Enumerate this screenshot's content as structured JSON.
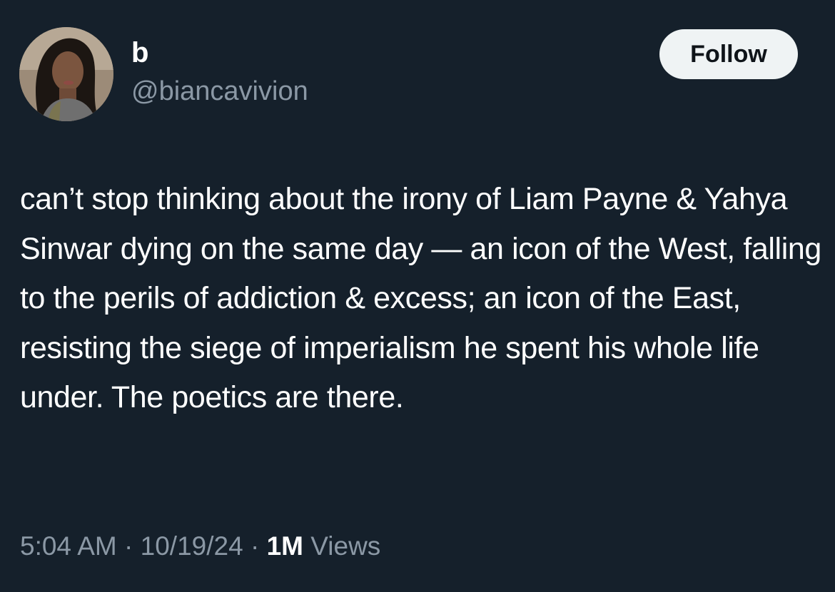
{
  "author": {
    "display_name": "b",
    "handle": "@biancavivion",
    "avatar_icon": "user-avatar-photo"
  },
  "follow_button": {
    "label": "Follow"
  },
  "tweet": {
    "text": "can’t stop thinking about the irony of Liam Payne & Yahya Sinwar dying on the same day — an icon of the West, falling to the perils of addiction & excess; an icon of the East, resisting the siege of imperialism he spent his whole life under. The poetics are there."
  },
  "meta": {
    "time": "5:04 AM",
    "separator": "·",
    "date": "10/19/24",
    "views_count": "1M",
    "views_label": "Views"
  },
  "colors": {
    "background": "#15202b",
    "primary_text": "#ffffff",
    "secondary_text": "#8b98a5",
    "follow_button_bg": "#eff3f4",
    "follow_button_text": "#0f1419"
  }
}
